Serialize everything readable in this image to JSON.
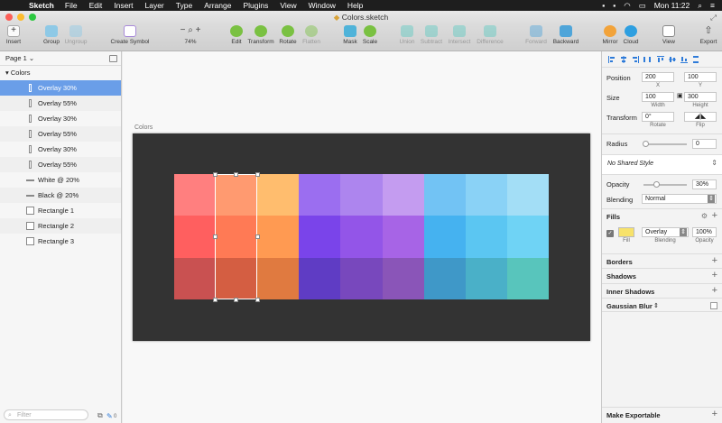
{
  "menubar": {
    "app_name": "Sketch",
    "items": [
      "File",
      "Edit",
      "Insert",
      "Layer",
      "Type",
      "Arrange",
      "Plugins",
      "View",
      "Window",
      "Help"
    ],
    "clock": "Mon 11:22"
  },
  "window": {
    "title": "Colors.sketch"
  },
  "toolbar": {
    "insert": "Insert",
    "group": "Group",
    "ungroup": "Ungroup",
    "create_symbol": "Create Symbol",
    "zoom_level": "74%",
    "edit": "Edit",
    "transform": "Transform",
    "rotate": "Rotate",
    "flatten": "Flatten",
    "mask": "Mask",
    "scale": "Scale",
    "union": "Union",
    "subtract": "Subtract",
    "intersect": "Intersect",
    "difference": "Difference",
    "forward": "Forward",
    "backward": "Backward",
    "mirror": "Mirror",
    "cloud": "Cloud",
    "view": "View",
    "export": "Export"
  },
  "layers": {
    "page": "Page 1",
    "group": "Colors",
    "items": [
      {
        "name": "Overlay 30%",
        "icon": "bar",
        "selected": true
      },
      {
        "name": "Overlay 55%",
        "icon": "bar"
      },
      {
        "name": "Overlay 30%",
        "icon": "bar"
      },
      {
        "name": "Overlay 55%",
        "icon": "bar"
      },
      {
        "name": "Overlay 30%",
        "icon": "bar"
      },
      {
        "name": "Overlay 55%",
        "icon": "bar"
      },
      {
        "name": "White @ 20%",
        "icon": "line"
      },
      {
        "name": "Black @ 20%",
        "icon": "line"
      },
      {
        "name": "Rectangle 1",
        "icon": "rect"
      },
      {
        "name": "Rectangle 2",
        "icon": "rect"
      },
      {
        "name": "Rectangle 3",
        "icon": "rect"
      }
    ],
    "filter_placeholder": "Filter",
    "count": "0"
  },
  "canvas": {
    "artboard_label": "Colors",
    "swatches": [
      [
        "#ff7f7f",
        "#ff9a70",
        "#ffbd6e",
        "#9b6ef0",
        "#ad85ee",
        "#c49cf0",
        "#72c3f4",
        "#8ad2f6",
        "#a3def6"
      ],
      [
        "#ff5f5f",
        "#ff7a55",
        "#ff9a52",
        "#7a44ea",
        "#9355e8",
        "#a764e6",
        "#45b2f0",
        "#5bc6f2",
        "#6fd3f5"
      ],
      [
        "#c95151",
        "#d45e42",
        "#e07a40",
        "#5f3cc4",
        "#7848bd",
        "#8a55b8",
        "#3f98c8",
        "#4ab0c8",
        "#58c5bc"
      ]
    ]
  },
  "inspector": {
    "position_label": "Position",
    "pos_x": "200",
    "pos_y": "100",
    "x_label": "X",
    "y_label": "Y",
    "size_label": "Size",
    "width": "100",
    "height": "300",
    "width_label": "Width",
    "height_label": "Height",
    "transform_label": "Transform",
    "rotate_value": "0°",
    "rotate_label": "Rotate",
    "flip_label": "Flip",
    "radius_label": "Radius",
    "radius_value": "0",
    "shared_style": "No Shared Style",
    "opacity_label": "Opacity",
    "opacity_value": "30%",
    "opacity_level": 0.3,
    "blending_label": "Blending",
    "blending_value": "Normal",
    "fills_label": "Fills",
    "fill_color": "#f7e26b",
    "fill_blend": "Overlay",
    "fill_opacity": "100%",
    "fill_sub": "Fill",
    "fill_blend_sub": "Blending",
    "fill_opacity_sub": "Opacity",
    "borders_label": "Borders",
    "shadows_label": "Shadows",
    "inner_shadows_label": "Inner Shadows",
    "gaussian_blur_label": "Gaussian Blur",
    "make_exportable": "Make Exportable"
  }
}
